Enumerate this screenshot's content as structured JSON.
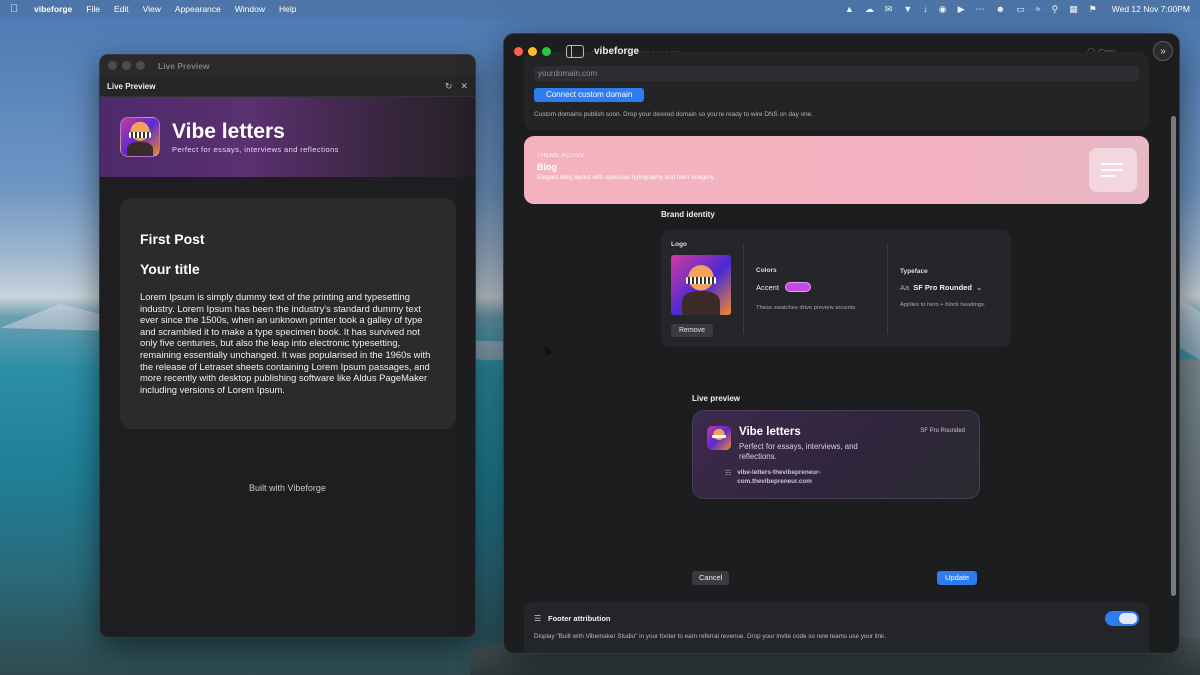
{
  "menubar": {
    "app_name": "vibeforge",
    "menus": [
      "File",
      "Edit",
      "View",
      "Appearance",
      "Window",
      "Help"
    ],
    "clock": "Wed 12 Nov  7:00PM",
    "status_icons": [
      "figma-icon",
      "cloud-icon",
      "bell-icon",
      "shield-icon",
      "filter-icon",
      "airdrop-icon",
      "play-icon",
      "dots-icon",
      "user-icon",
      "battery-icon",
      "wifi-icon",
      "search-icon",
      "control-center-icon",
      "flag-icon"
    ]
  },
  "left_window": {
    "title": "Live Preview",
    "header_label": "Live Preview",
    "hero": {
      "title": "Vibe letters",
      "subtitle": "Perfect for essays, interviews and reflections"
    },
    "post": {
      "title": "First Post",
      "subtitle": "Your title",
      "body": "Lorem Ipsum is simply dummy text of the printing and typesetting industry. Lorem Ipsum has been the industry's standard dummy text ever since the 1500s, when an unknown printer took a galley of type and scrambled it to make a type specimen book. It has survived not only five centuries, but also the leap into electronic typesetting, remaining essentially unchanged. It was popularised in the 1960s with the release of Letraset sheets containing Lorem Ipsum passages, and more recently with desktop publishing software like Aldus PageMaker including versions of Lorem Ipsum."
    },
    "footer": "Built with Vibeforge"
  },
  "right_window": {
    "title": "vibeforge",
    "ghost_text": "the.thevibepreneur.com",
    "copy_label": "Copy",
    "domain": {
      "placeholder": "yourdomain.com",
      "connect_label": "Connect custom domain",
      "note": "Custom domains publish soon. Drop your desired domain so you're ready to wire DNS on day one."
    },
    "theme": {
      "kicker": "THEME ACTIVE",
      "name": "Blog",
      "description": "Elegant blog layout with spacious typography and hero imagery."
    },
    "brand": {
      "label": "Brand identity",
      "logo_label": "Logo",
      "remove_label": "Remove",
      "colors_label": "Colors",
      "accent_label": "Accent",
      "accent_color": "#c24be8",
      "colors_note": "These swatches drive preview accents.",
      "typeface_label": "Typeface",
      "typeface_prefix": "Aa",
      "typeface_value": "SF Pro Rounded",
      "typeface_note": "Applies to hero + block headings."
    },
    "live_preview": {
      "label": "Live preview",
      "title": "Vibe letters",
      "subtitle": "Perfect for essays, interviews, and reflections.",
      "font": "SF Pro Rounded",
      "url": "vibe-letters-thevibepreneur-com.thevibepreneur.com"
    },
    "actions": {
      "cancel": "Cancel",
      "update": "Update"
    },
    "footer_attribution": {
      "title": "Footer attribution",
      "note": "Display \"Built with Vibemaker Studio\" in your footer to earn referral revenue. Drop your invite code so new teams use your link.",
      "enabled": true
    }
  },
  "colors": {
    "accent_blue": "#2f7bf0",
    "theme_pink": "#f3b2be"
  }
}
